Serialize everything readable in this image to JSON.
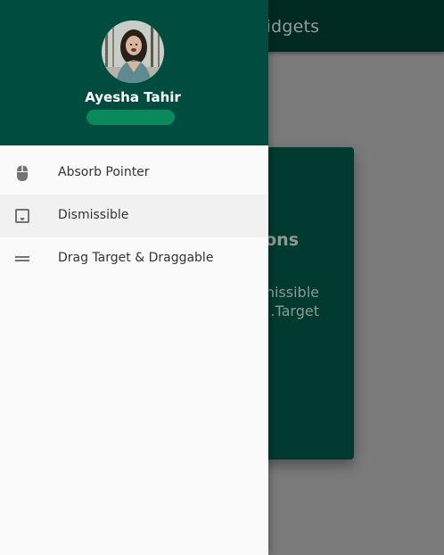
{
  "appbar": {
    "title_visible": "Widgets"
  },
  "card": {
    "heading_visible": "ons",
    "body_visible": [
      "nissible,",
      "Target."
    ]
  },
  "drawer": {
    "user": {
      "name": "Ayesha Tahir"
    },
    "items": [
      {
        "label": "Absorb Pointer",
        "icon": "mouse-icon"
      },
      {
        "label": "Dismissible",
        "icon": "inbox-icon",
        "selected": true
      },
      {
        "label": "Drag Target & Draggable",
        "icon": "drag-handle-icon"
      }
    ]
  },
  "colors": {
    "drawer_header": "#004d40",
    "accent_pill": "#0a8a5a",
    "scrim_background": "#7a7a7a",
    "card": "#013a2e"
  }
}
